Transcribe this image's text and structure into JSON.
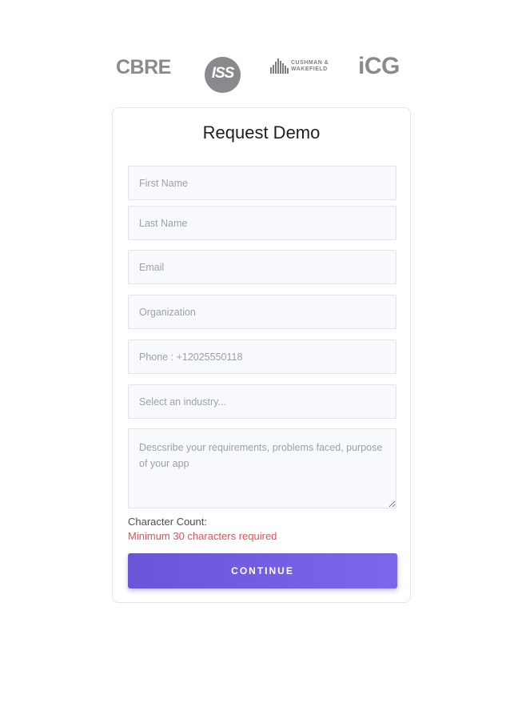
{
  "logos": {
    "cbre": "CBRE",
    "iss": "ISS",
    "cushman_line1": "CUSHMAN &",
    "cushman_line2": "WAKEFIELD",
    "icg": "iCG"
  },
  "form": {
    "title": "Request Demo",
    "first_name": {
      "placeholder": "First Name",
      "value": ""
    },
    "last_name": {
      "placeholder": "Last Name",
      "value": ""
    },
    "email": {
      "placeholder": "Email",
      "value": ""
    },
    "organization": {
      "placeholder": "Organization",
      "value": ""
    },
    "phone": {
      "placeholder": "Phone : +12025550118",
      "value": ""
    },
    "industry": {
      "placeholder": "Select an industry...",
      "value": ""
    },
    "requirements": {
      "placeholder": "Descsribe your requirements, problems faced, purpose of your app",
      "value": ""
    },
    "character_count_label": "Character Count:",
    "error_message": "Minimum 30 characters required",
    "continue_label": "CONTINUE"
  },
  "colors": {
    "button_start": "#6a55d9",
    "button_end": "#7c66ec",
    "error": "#e4505c",
    "logo_gray": "#8a8a8e"
  }
}
